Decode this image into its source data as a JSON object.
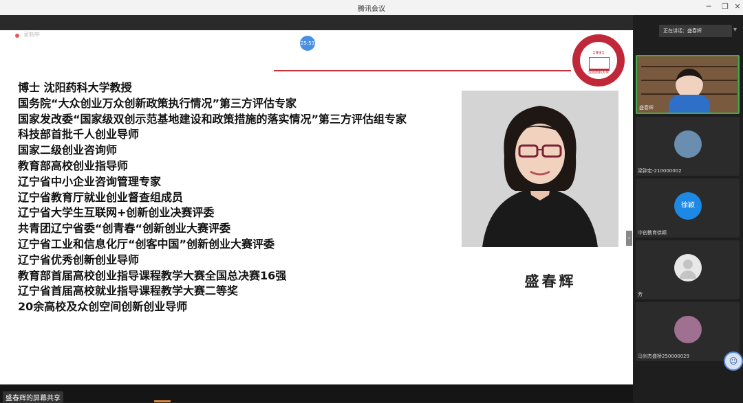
{
  "window": {
    "title": "腾讯会议"
  },
  "toolbar": {
    "recording_label": "录制中",
    "timer": "25:53"
  },
  "slide": {
    "credentials": [
      "博士  沈阳药科大学教授",
      "国务院“大众创业万众创新政策执行情况”第三方评估专家",
      "国家发改委“国家级双创示范基地建设和政策措施的落实情况”第三方评估组专家",
      "科技部首批千人创业导师",
      "国家二级创业咨询师",
      "教育部高校创业指导师",
      "辽宁省中小企业咨询管理专家",
      "辽宁省教育厅就业创业督查组成员",
      "辽宁省大学生互联网+创新创业决赛评委",
      "共青团辽宁省委“创青春“创新创业大赛评委",
      "辽宁省工业和信息化厅“创客中国”创新创业大赛评委",
      "辽宁省优秀创新创业导师",
      "教育部首届高校创业指导课程教学大赛全国总决赛16强",
      "辽宁省首届高校就业指导课程教学大赛二等奖",
      "20余高校及众创空间创新创业导师"
    ],
    "person_name": "盛春辉",
    "logo": {
      "year": "1931",
      "name": "沈阳药科大学"
    }
  },
  "sidebar": {
    "speaking_label": "正在讲话：盛春辉",
    "participants": [
      {
        "name": "盛春辉",
        "type": "camera",
        "active": true
      },
      {
        "name": "梁钟宏-210000002",
        "type": "photo"
      },
      {
        "name": "中创教育徐颖",
        "type": "initials",
        "initials": "徐颖",
        "color": "#1e88e5"
      },
      {
        "name": "芳",
        "type": "default"
      },
      {
        "name": "马剑杰盛桥250000029",
        "type": "photo"
      }
    ]
  },
  "bottombar": {
    "share_label": "盛春辉的屏幕共享"
  },
  "colors": {
    "accent_green": "#3fae47",
    "accent_red": "#c0283a",
    "avatar_blue": "#1e88e5"
  }
}
